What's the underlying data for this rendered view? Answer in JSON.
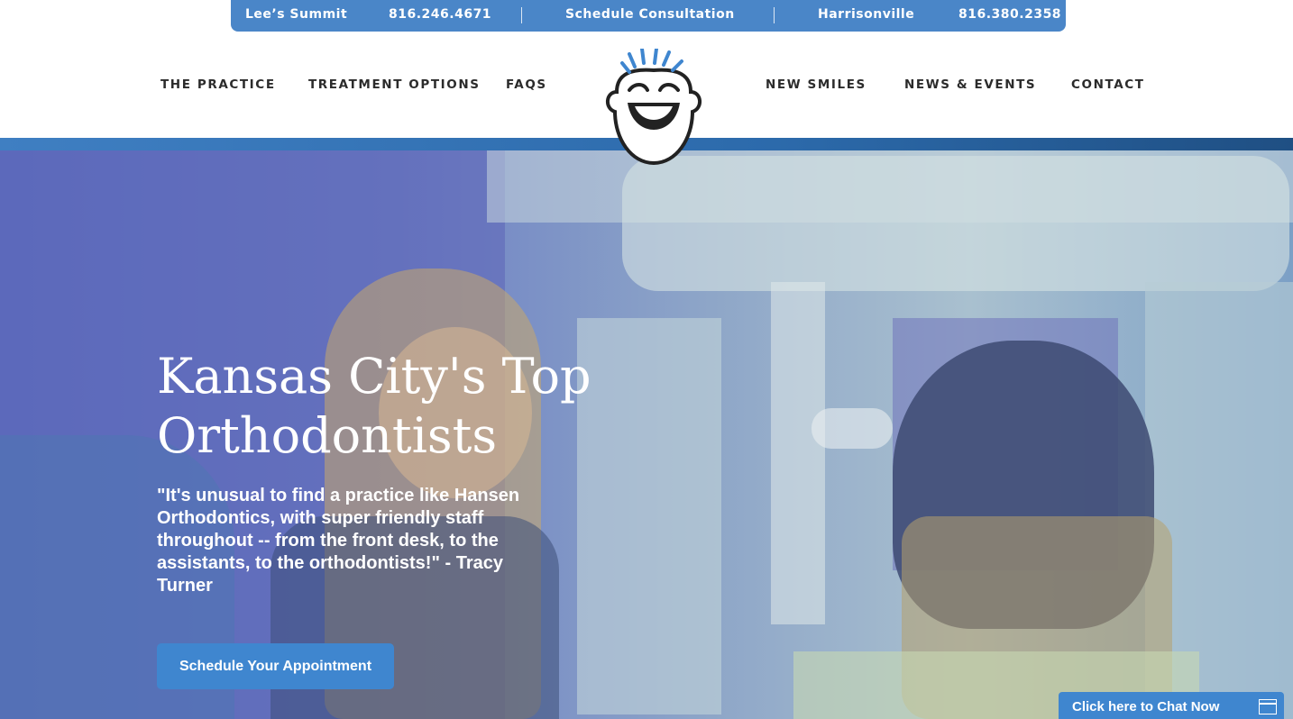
{
  "topbar": {
    "location_1": "Lee’s Summit",
    "phone_1": "816.246.4671",
    "schedule": "Schedule Consultation",
    "location_2": "Harrisonville",
    "phone_2": "816.380.2358"
  },
  "nav": {
    "left": [
      "THE PRACTICE",
      "TREATMENT OPTIONS",
      "FAQS"
    ],
    "right": [
      "NEW SMILES",
      "NEWS & EVENTS",
      "CONTACT"
    ]
  },
  "logo": {
    "icon": "smiling-face-logo"
  },
  "hero": {
    "title_line1": "Kansas City's Top",
    "title_line2": "Orthodontists",
    "quote": "\"It's unusual to find a practice like Hansen Orthodontics, with super friendly staff throughout -- from the front desk, to the assistants, to the orthodontists!\" - Tracy Turner",
    "cta_label": "Schedule Your Appointment"
  },
  "chat": {
    "label": "Click here to Chat Now",
    "icon": "chat-window-icon"
  },
  "colors": {
    "brand_blue": "#4a86c8",
    "button_blue": "#3f86cf",
    "nav_text": "#2b2b2b"
  }
}
